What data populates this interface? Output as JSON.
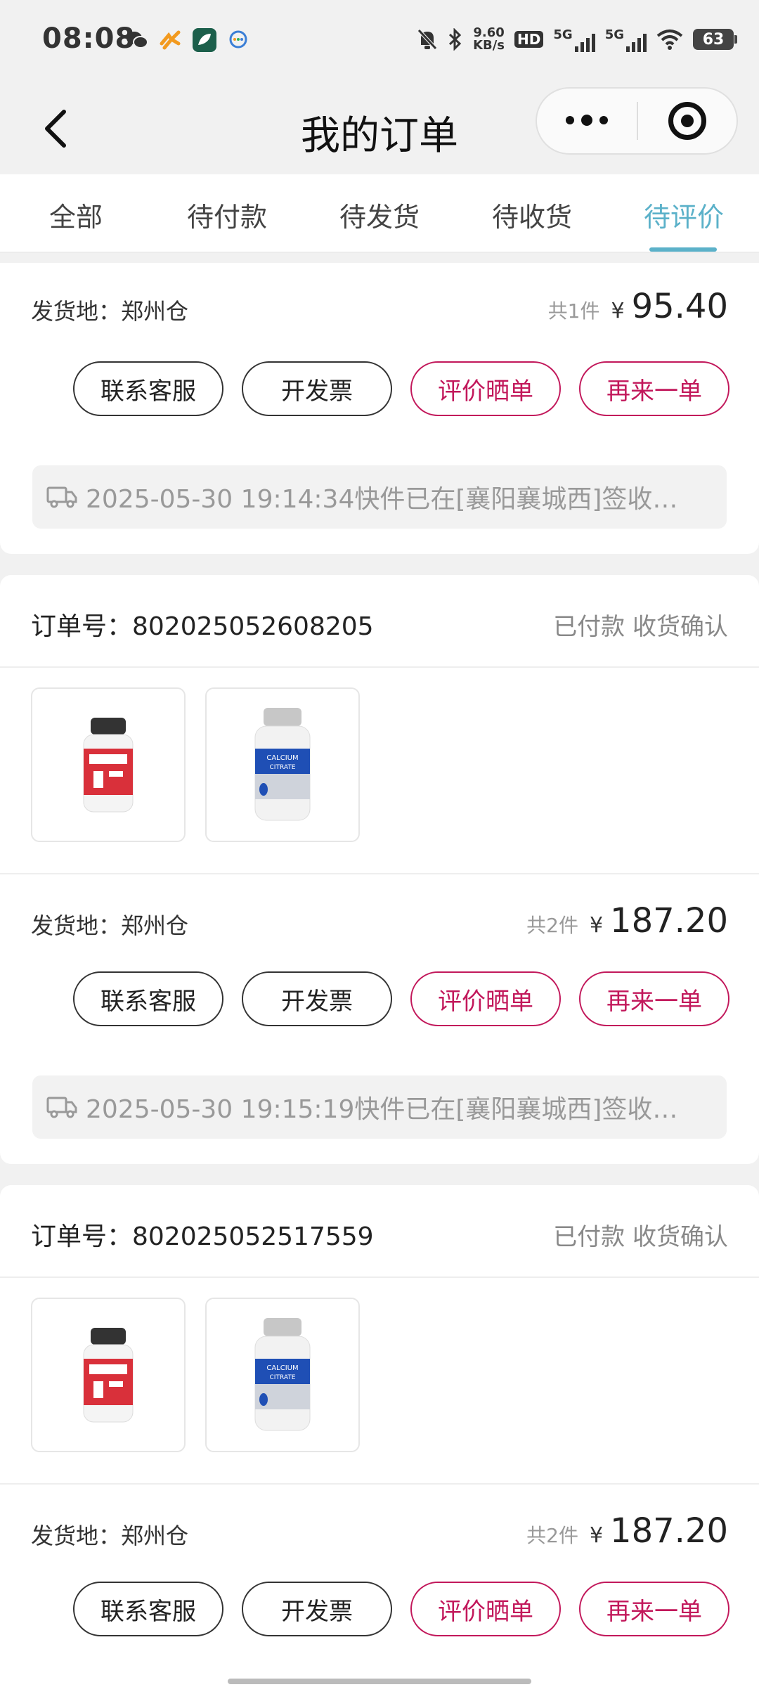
{
  "status_bar": {
    "time": "08:08",
    "net_speed_value": "9.60",
    "net_speed_unit": "KB/s",
    "hd": "HD",
    "sig1": "5G",
    "sig2": "5G",
    "battery": "63"
  },
  "header": {
    "title": "我的订单"
  },
  "tabs": [
    {
      "label": "全部"
    },
    {
      "label": "待付款"
    },
    {
      "label": "待发货"
    },
    {
      "label": "待收货"
    },
    {
      "label": "待评价",
      "active": true
    }
  ],
  "common": {
    "ship_from": "发货地：郑州仓",
    "currency": "¥",
    "buttons": [
      "联系客服",
      "开发票",
      "评价晒单",
      "再来一单"
    ]
  },
  "orders": [
    {
      "count": "共1件",
      "amount": "95.40",
      "logistics": "2025-05-30 19:14:34快件已在[襄阳襄城西]签收…"
    },
    {
      "order_no": "订单号：802025052608205",
      "status": "已付款 收货确认",
      "products": [
        "red-supplement-bottle",
        "calcium-citrate-bottle"
      ],
      "count": "共2件",
      "amount": "187.20",
      "logistics": "2025-05-30 19:15:19快件已在[襄阳襄城西]签收…"
    },
    {
      "order_no": "订单号：802025052517559",
      "status": "已付款 收货确认",
      "products": [
        "red-supplement-bottle",
        "calcium-citrate-bottle"
      ],
      "count": "共2件",
      "amount": "187.20"
    }
  ],
  "colors": {
    "accent": "#5bb1c9",
    "pink": "#c2185b"
  }
}
